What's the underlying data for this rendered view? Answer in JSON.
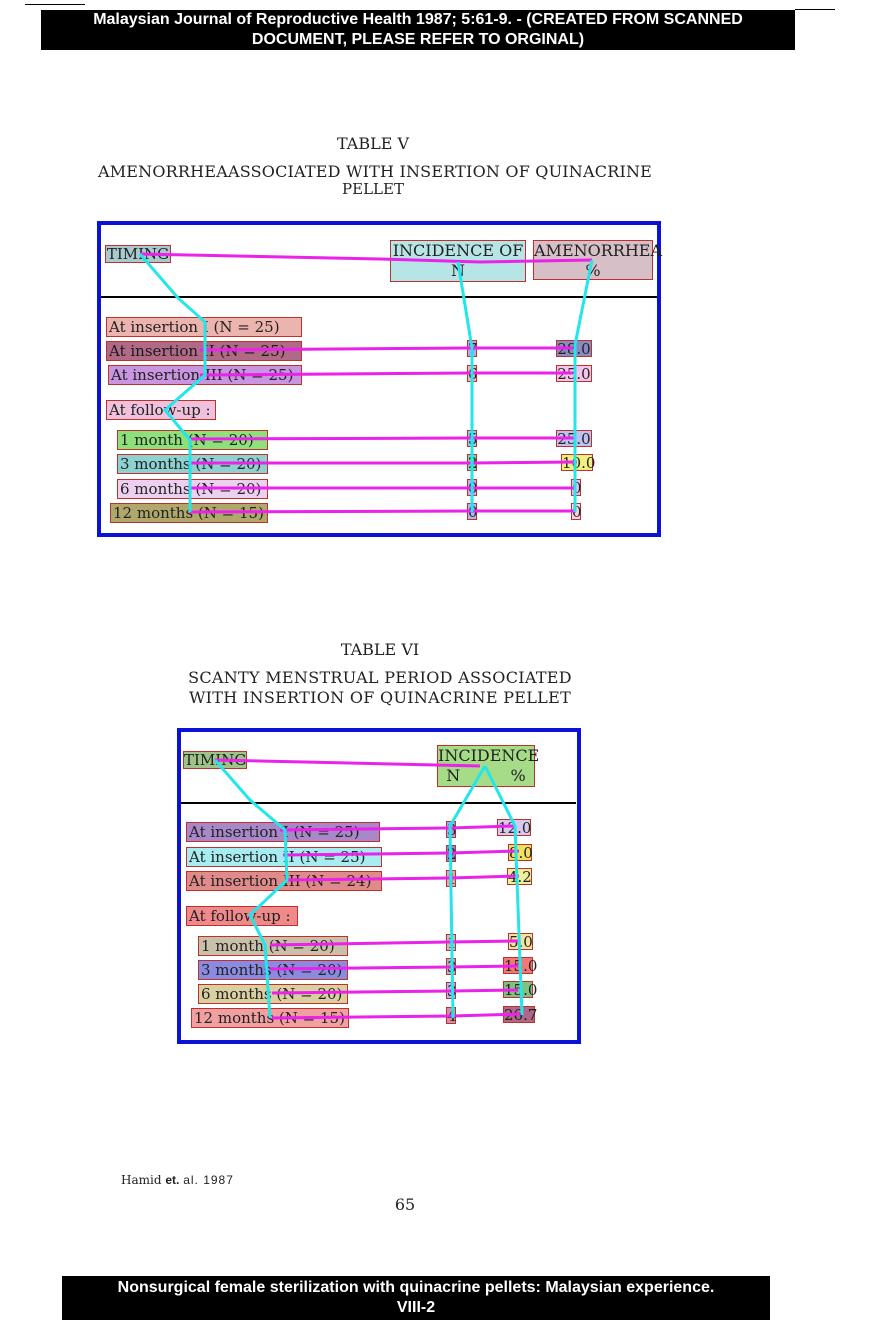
{
  "header_banner": {
    "line1": "Malaysian Journal of Reproductive Health 1987; 5:61-9. - (CREATED FROM SCANNED",
    "line2": "DOCUMENT, PLEASE REFER TO ORGINAL)"
  },
  "table5": {
    "label": "TABLE V",
    "title_line1": "AMENORRHEAASSOCIATED WITH INSERTION OF QUINACRINE",
    "title_line2": "PELLET",
    "col_timing": "TIMING",
    "col_incidence_a": "INCIDENCE OF",
    "col_incidence_b": "N",
    "col_amen_a": "AMENORRHEA",
    "col_amen_b": "%",
    "rows": [
      {
        "label": "At insertion  I (N = 25)",
        "n": "",
        "pct": ""
      },
      {
        "label": "At insertion II (N = 25)",
        "n": "7",
        "pct": "28.0"
      },
      {
        "label": "At insertion III (N = 25)",
        "n": "6",
        "pct": "25.0"
      },
      {
        "label": "At follow-up :",
        "n": "",
        "pct": ""
      },
      {
        "label": "1 month (N = 20)",
        "n": "5",
        "pct": "25.0"
      },
      {
        "label": "3 months (N = 20)",
        "n": "2",
        "pct": "10.0"
      },
      {
        "label": "6 months (N = 20)",
        "n": "0",
        "pct": "0"
      },
      {
        "label": "12 months (N = 15)",
        "n": "0",
        "pct": "0"
      }
    ]
  },
  "table6": {
    "label": "TABLE VI",
    "title_line1": "SCANTY MENSTRUAL PERIOD ASSOCIATED",
    "title_line2": "WITH INSERTION OF QUINACRINE PELLET",
    "col_timing": "TIMING",
    "col_incidence_a": "INCIDENCE",
    "col_incidence_n": "N",
    "col_incidence_pct": "%",
    "rows": [
      {
        "label": "At insertion  I (N = 25)",
        "n": "3",
        "pct": "12.0"
      },
      {
        "label": "At insertion II (N = 25)",
        "n": "2",
        "pct": "8.0"
      },
      {
        "label": "At insertion III (N = 24)",
        "n": "1",
        "pct": "4.2"
      },
      {
        "label": "At follow-up :",
        "n": "",
        "pct": ""
      },
      {
        "label": "1 month (N = 20)",
        "n": "1",
        "pct": "5.0"
      },
      {
        "label": "3 months (N = 20)",
        "n": "3",
        "pct": "15.0"
      },
      {
        "label": "6 months (N = 20)",
        "n": "3",
        "pct": "15.0"
      },
      {
        "label": "12 months (N = 15)",
        "n": "4",
        "pct": "26.7"
      }
    ]
  },
  "citation": {
    "author": "Hamid",
    "etal": "et.",
    "rest": "al. 1987"
  },
  "page_number": "65",
  "footer_banner": {
    "line1": "Nonsurgical female sterilization with quinacrine pellets: Malaysian experience.",
    "line2": "VIII-2"
  }
}
